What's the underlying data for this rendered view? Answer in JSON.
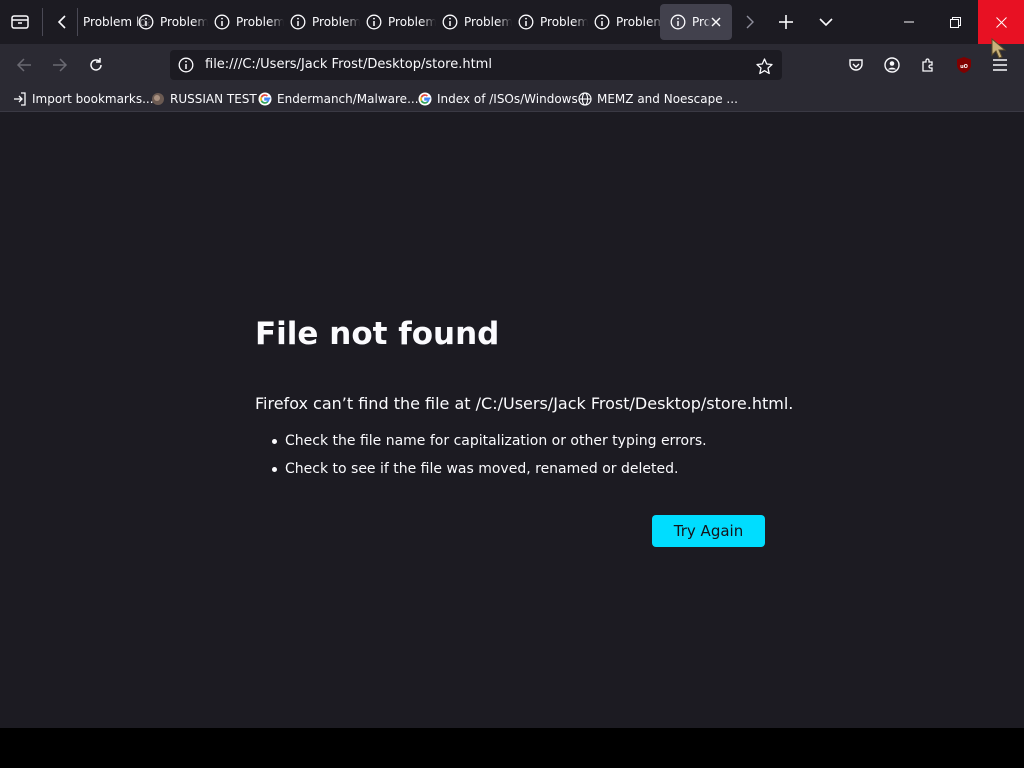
{
  "tabs": [
    {
      "title": "Problem loading page",
      "icon": "info-icon",
      "active": false
    },
    {
      "title": "Problem loading page",
      "icon": "info-icon",
      "active": false
    },
    {
      "title": "Problem loading page",
      "icon": "info-icon",
      "active": false
    },
    {
      "title": "Problem loading page",
      "icon": "info-icon",
      "active": false
    },
    {
      "title": "Problem loading page",
      "icon": "info-icon",
      "active": false
    },
    {
      "title": "Problem loading page",
      "icon": "info-icon",
      "active": false
    },
    {
      "title": "Problem loading page",
      "icon": "info-icon",
      "active": false
    },
    {
      "title": "Problem loading page",
      "icon": "info-icon",
      "active": false
    },
    {
      "title": "Problem loading page",
      "icon": "info-icon",
      "active": true
    }
  ],
  "navbar": {
    "url": "file:///C:/Users/Jack Frost/Desktop/store.html"
  },
  "bookmarks": [
    {
      "label": "Import bookmarks...",
      "icon": "import-icon"
    },
    {
      "label": "RUSSIAN TEST",
      "icon": "site-favicon"
    },
    {
      "label": "Endermanch/Malware...",
      "icon": "google-icon"
    },
    {
      "label": "Index of /ISOs/Windows",
      "icon": "google-icon"
    },
    {
      "label": "MEMZ and Noescape ...",
      "icon": "globe-icon"
    }
  ],
  "error": {
    "title": "File not found",
    "description": "Firefox can’t find the file at /C:/Users/Jack Frost/Desktop/store.html.",
    "suggestions": [
      "Check the file name for capitalization or other typing errors.",
      "Check to see if the file was moved, renamed or deleted."
    ],
    "button_label": "Try Again"
  },
  "colors": {
    "accent": "#00ddff",
    "background": "#1c1b22",
    "toolbar": "#2b2a33",
    "close_hover": "#e81123"
  }
}
